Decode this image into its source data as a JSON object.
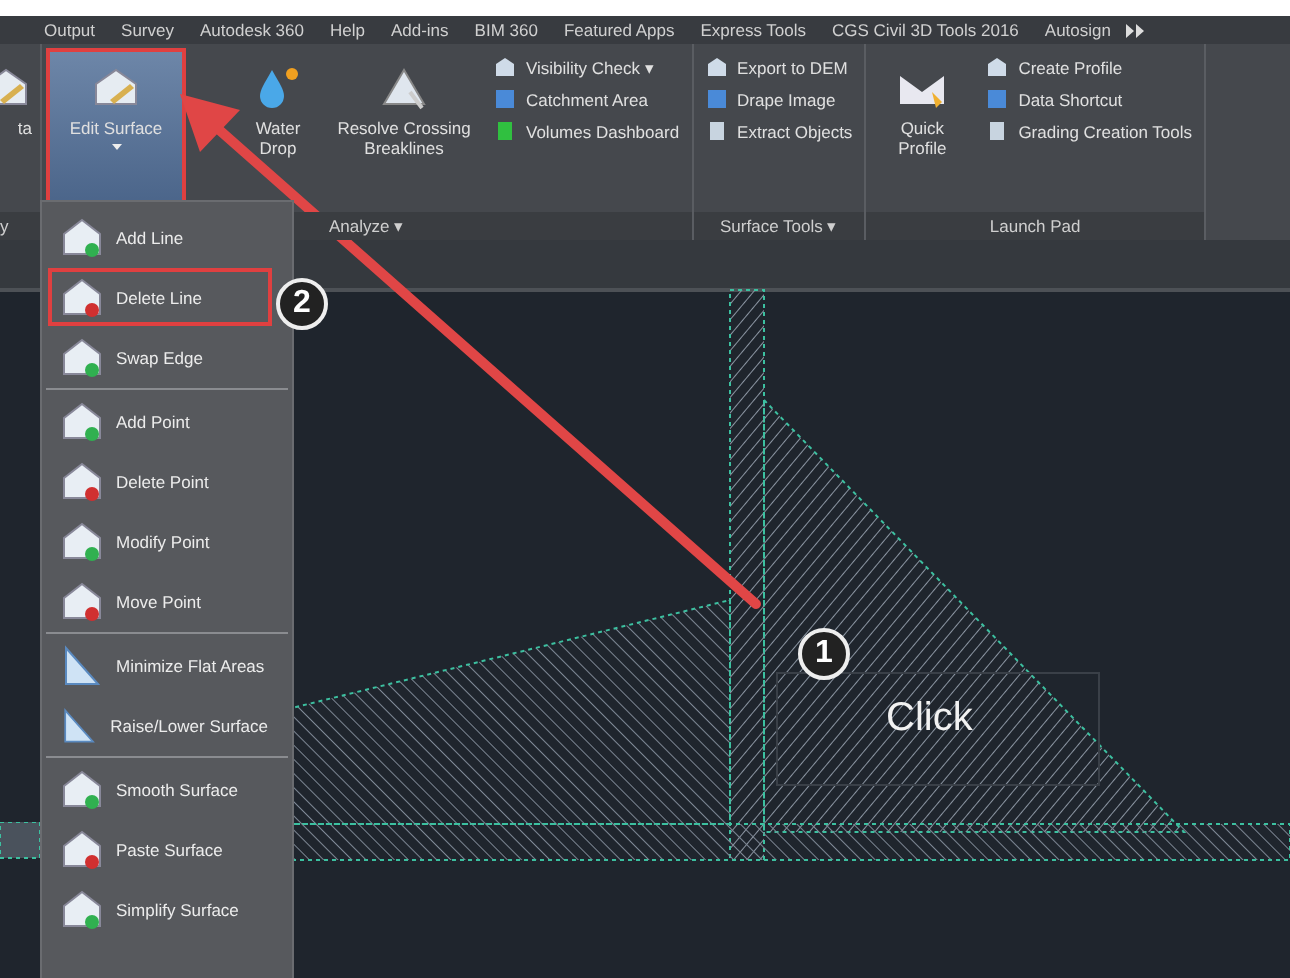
{
  "tabs": [
    {
      "label": "Output"
    },
    {
      "label": "Survey"
    },
    {
      "label": "Autodesk 360"
    },
    {
      "label": "Help"
    },
    {
      "label": "Add-ins"
    },
    {
      "label": "BIM 360"
    },
    {
      "label": "Featured Apps"
    },
    {
      "label": "Express Tools"
    },
    {
      "label": "CGS Civil 3D Tools 2016"
    },
    {
      "label": "Autosign"
    }
  ],
  "ribbon": {
    "panels": [
      {
        "label": "y",
        "large": [
          {
            "label": "ta",
            "selected": false,
            "highlighted": false,
            "has_menu": false
          }
        ]
      },
      {
        "label": "Analyze ▾",
        "large": [
          {
            "label": "Edit Surface",
            "selected": true,
            "highlighted": true,
            "has_menu": true
          },
          {
            "label": "Water Drop",
            "selected": false,
            "highlighted": false,
            "has_menu": false
          },
          {
            "label": "Resolve Crossing Breaklines",
            "selected": false,
            "highlighted": false,
            "has_menu": false
          }
        ],
        "small": [
          {
            "label": "Visibility Check ▾"
          },
          {
            "label": "Catchment Area"
          },
          {
            "label": "Volumes Dashboard"
          }
        ]
      },
      {
        "label": "Surface Tools ▾",
        "small": [
          {
            "label": "Export to DEM"
          },
          {
            "label": "Drape Image"
          },
          {
            "label": "Extract Objects"
          }
        ]
      },
      {
        "label": "Launch Pad",
        "large": [
          {
            "label": "Quick Profile",
            "selected": false,
            "highlighted": false,
            "has_menu": false
          }
        ],
        "small": [
          {
            "label": "Create Profile"
          },
          {
            "label": "Data Shortcut"
          },
          {
            "label": "Grading Creation Tools"
          }
        ]
      }
    ]
  },
  "edit_surface_menu": {
    "groups": [
      {
        "items": [
          {
            "label": "Add Line",
            "highlighted": false
          },
          {
            "label": "Delete Line",
            "highlighted": true
          },
          {
            "label": "Swap Edge",
            "highlighted": false
          }
        ]
      },
      {
        "items": [
          {
            "label": "Add Point",
            "highlighted": false
          },
          {
            "label": "Delete Point",
            "highlighted": false
          },
          {
            "label": "Modify Point",
            "highlighted": false
          },
          {
            "label": "Move Point",
            "highlighted": false
          }
        ]
      },
      {
        "items": [
          {
            "label": "Minimize Flat Areas",
            "highlighted": false
          },
          {
            "label": "Raise/Lower Surface",
            "highlighted": false
          }
        ]
      },
      {
        "items": [
          {
            "label": "Smooth Surface",
            "highlighted": false
          },
          {
            "label": "Paste Surface",
            "highlighted": false
          },
          {
            "label": "Simplify Surface",
            "highlighted": false
          }
        ]
      }
    ]
  },
  "callouts": [
    {
      "number": "2"
    },
    {
      "number": "1"
    }
  ],
  "canvas_label": "Click"
}
